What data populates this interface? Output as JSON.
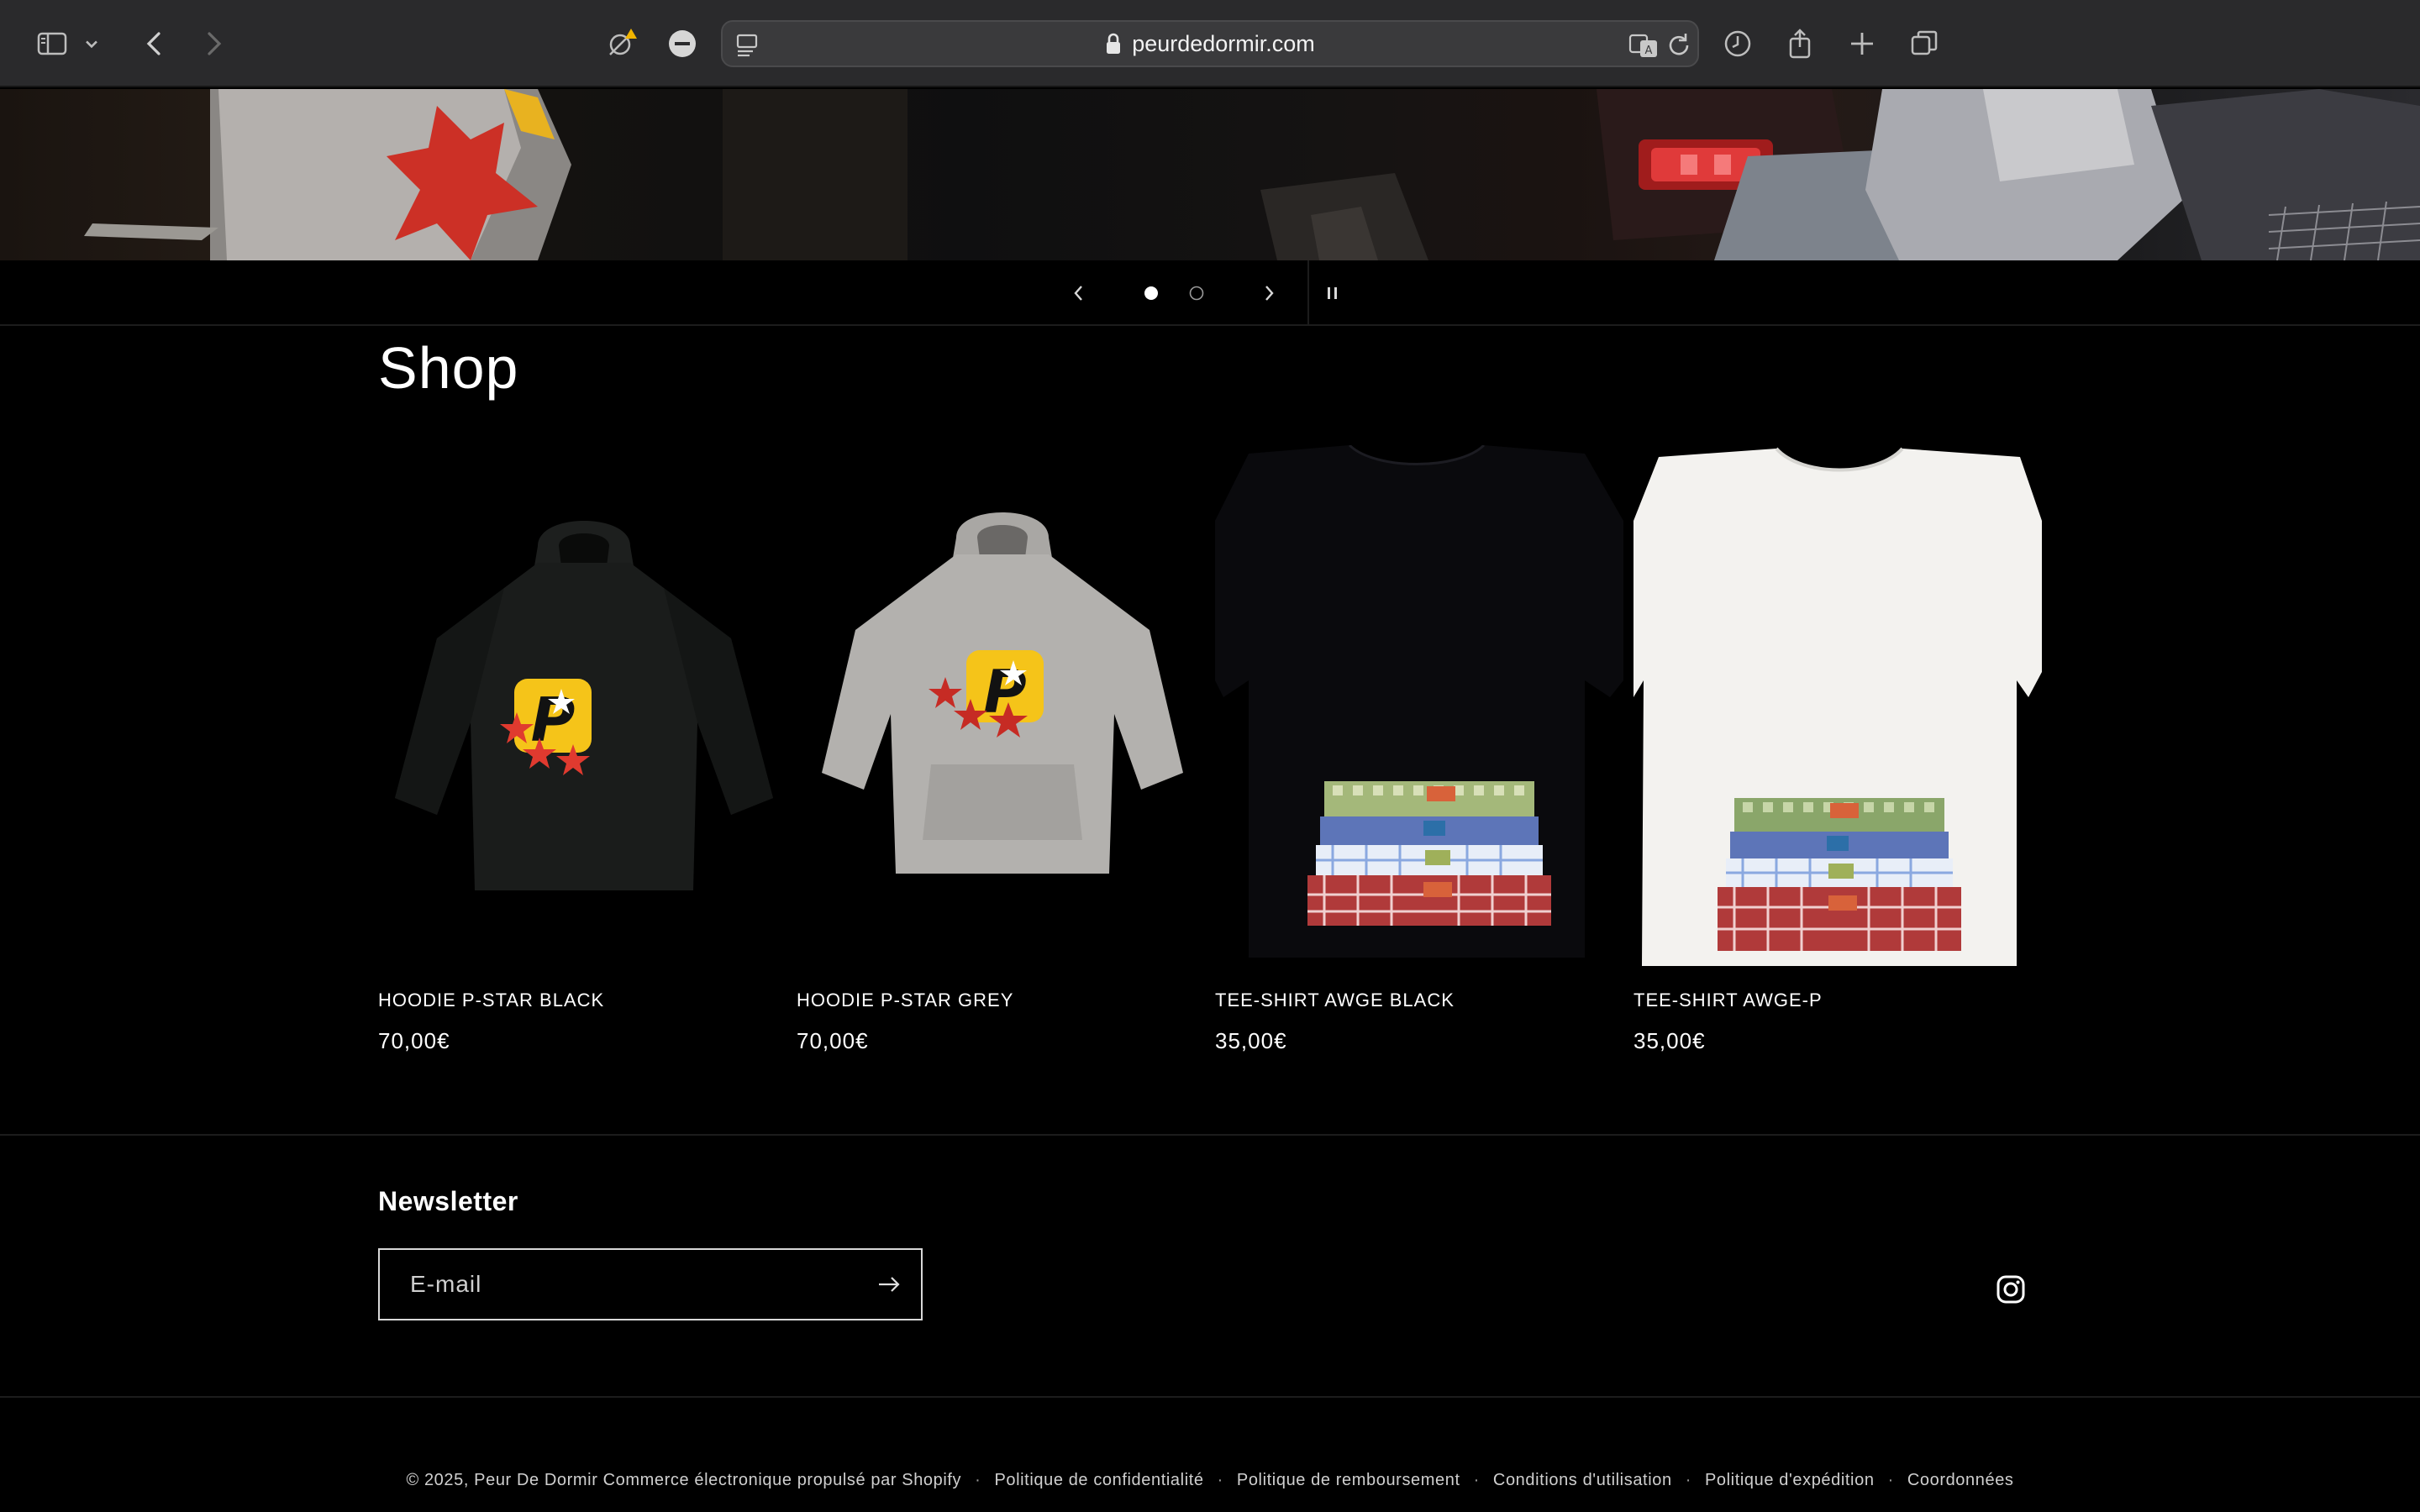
{
  "browser": {
    "url": "peurdedormir.com",
    "icons": [
      "sidebar-icon",
      "chevron-down-icon",
      "back-icon",
      "forward-icon",
      "privacy-shield-icon",
      "block-icon",
      "reader-icon",
      "lock-icon",
      "translate-icon",
      "reload-icon",
      "history-icon",
      "share-icon",
      "new-tab-icon",
      "tab-overview-icon"
    ]
  },
  "slider": {
    "slides": 2,
    "active": 1
  },
  "shop": {
    "title": "Shop",
    "products": [
      {
        "name": "HOODIE P-STAR BLACK",
        "price": "70,00€"
      },
      {
        "name": "HOODIE P-STAR GREY",
        "price": "70,00€"
      },
      {
        "name": "TEE-SHIRT AWGE BLACK",
        "price": "35,00€"
      },
      {
        "name": "TEE-SHIRT AWGE-P",
        "price": "35,00€"
      }
    ]
  },
  "newsletter": {
    "title": "Newsletter",
    "placeholder": "E-mail"
  },
  "footer": {
    "copyright": "© 2025, Peur De Dormir Commerce électronique propulsé par Shopify",
    "links": [
      "Politique de confidentialité",
      "Politique de remboursement",
      "Conditions d'utilisation",
      "Politique d'expédition",
      "Coordonnées"
    ]
  },
  "colors": {
    "background": "#000000",
    "toolbar": "#2a2a2c",
    "logo_yellow": "#f5c419",
    "star_red": "#e03a2f"
  }
}
